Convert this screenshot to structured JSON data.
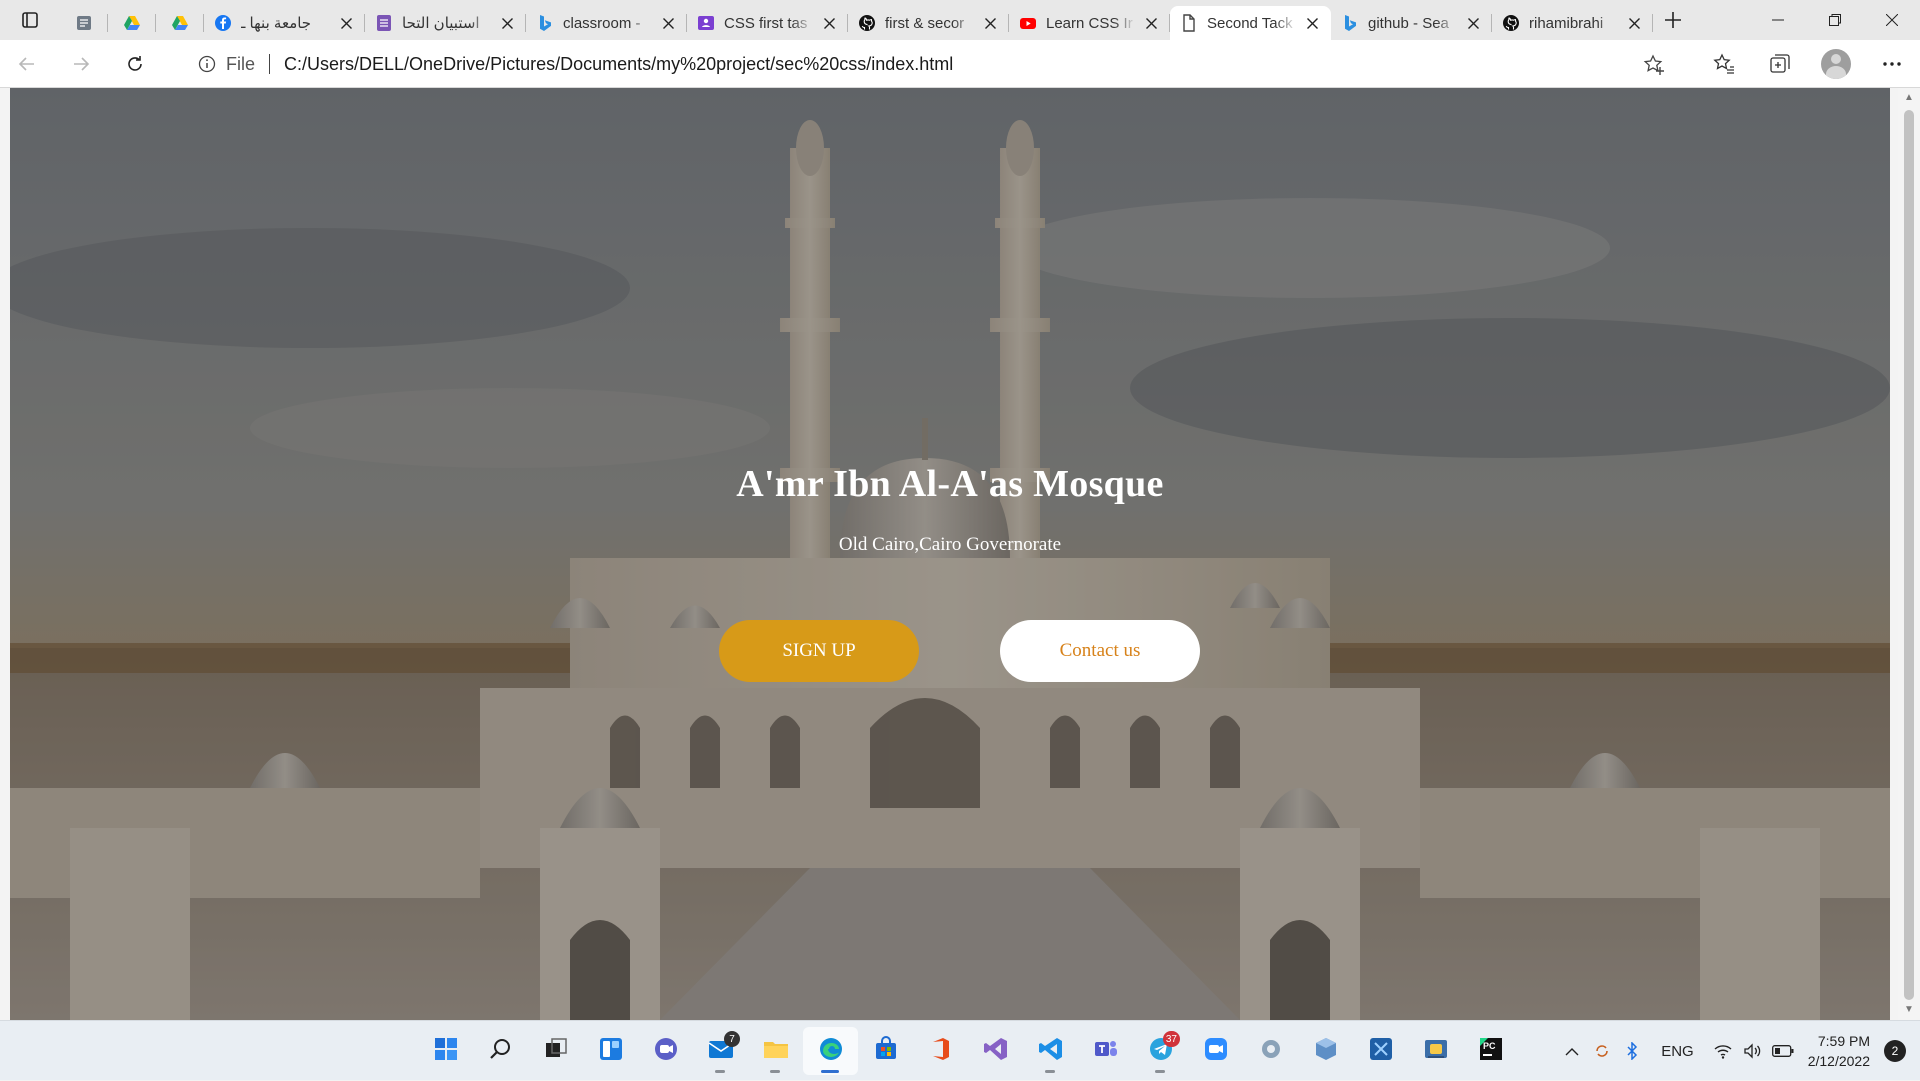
{
  "browser": {
    "tabs": [
      {
        "title": "",
        "favicon": "app-icon",
        "color": "#6f7a86"
      },
      {
        "title": "",
        "favicon": "google-drive-icon",
        "color": "#1fa463"
      },
      {
        "title": "",
        "favicon": "google-drive-icon",
        "color": "#1fa463"
      },
      {
        "title": "جامعة بنها ـ",
        "favicon": "facebook-icon",
        "color": "#1877f2"
      },
      {
        "title": "استبيان التحا",
        "favicon": "forms-icon",
        "color": "#7b55b5"
      },
      {
        "title": "classroom -",
        "favicon": "bing-icon",
        "color": "#2b8fe0"
      },
      {
        "title": "CSS first tas",
        "favicon": "classroom-icon",
        "color": "#7b3fd1"
      },
      {
        "title": "first & secor",
        "favicon": "github-icon",
        "color": "#111111"
      },
      {
        "title": "Learn CSS Ir",
        "favicon": "youtube-icon",
        "color": "#ff0000"
      },
      {
        "title": "Second Tack",
        "favicon": "document-icon",
        "color": "#444444"
      },
      {
        "title": "github - Sea",
        "favicon": "bing-icon",
        "color": "#2b8fe0"
      },
      {
        "title": "rihamibrahi",
        "favicon": "github-icon",
        "color": "#111111"
      }
    ],
    "active_tab_index": 9,
    "address": {
      "scheme": "File",
      "url": "C:/Users/DELL/OneDrive/Pictures/Documents/my%20project/sec%20css/index.html"
    }
  },
  "page": {
    "title": "A'mr Ibn Al-A'as Mosque",
    "subtitle": "Old Cairo,Cairo Governorate",
    "signup_label": "SIGN UP",
    "contact_label": "Contact us",
    "colors": {
      "signup_bg": "#d79a18",
      "contact_text": "#d7821a",
      "sky": "#7a7a7c",
      "stone": "#d9cfc2"
    }
  },
  "taskbar": {
    "apps": [
      {
        "name": "start-icon",
        "badge": ""
      },
      {
        "name": "search-icon",
        "badge": ""
      },
      {
        "name": "task-view-icon",
        "badge": ""
      },
      {
        "name": "widgets-icon",
        "badge": ""
      },
      {
        "name": "chat-icon",
        "badge": ""
      },
      {
        "name": "mail-icon",
        "badge": "7"
      },
      {
        "name": "file-explorer-icon",
        "badge": ""
      },
      {
        "name": "edge-icon",
        "badge": ""
      },
      {
        "name": "store-icon",
        "badge": ""
      },
      {
        "name": "office-icon",
        "badge": ""
      },
      {
        "name": "visual-studio-icon",
        "badge": ""
      },
      {
        "name": "vscode-icon",
        "badge": ""
      },
      {
        "name": "teams-icon",
        "badge": ""
      },
      {
        "name": "telegram-icon",
        "badge": "37"
      },
      {
        "name": "zoom-icon",
        "badge": ""
      },
      {
        "name": "app-icon",
        "badge": ""
      },
      {
        "name": "virtualbox-icon",
        "badge": ""
      },
      {
        "name": "snipping-icon",
        "badge": ""
      },
      {
        "name": "python-icon",
        "badge": ""
      },
      {
        "name": "pycharm-icon",
        "badge": ""
      }
    ],
    "tray": {
      "language": "ENG",
      "time": "7:59 PM",
      "date": "2/12/2022",
      "notifications": "2"
    }
  }
}
